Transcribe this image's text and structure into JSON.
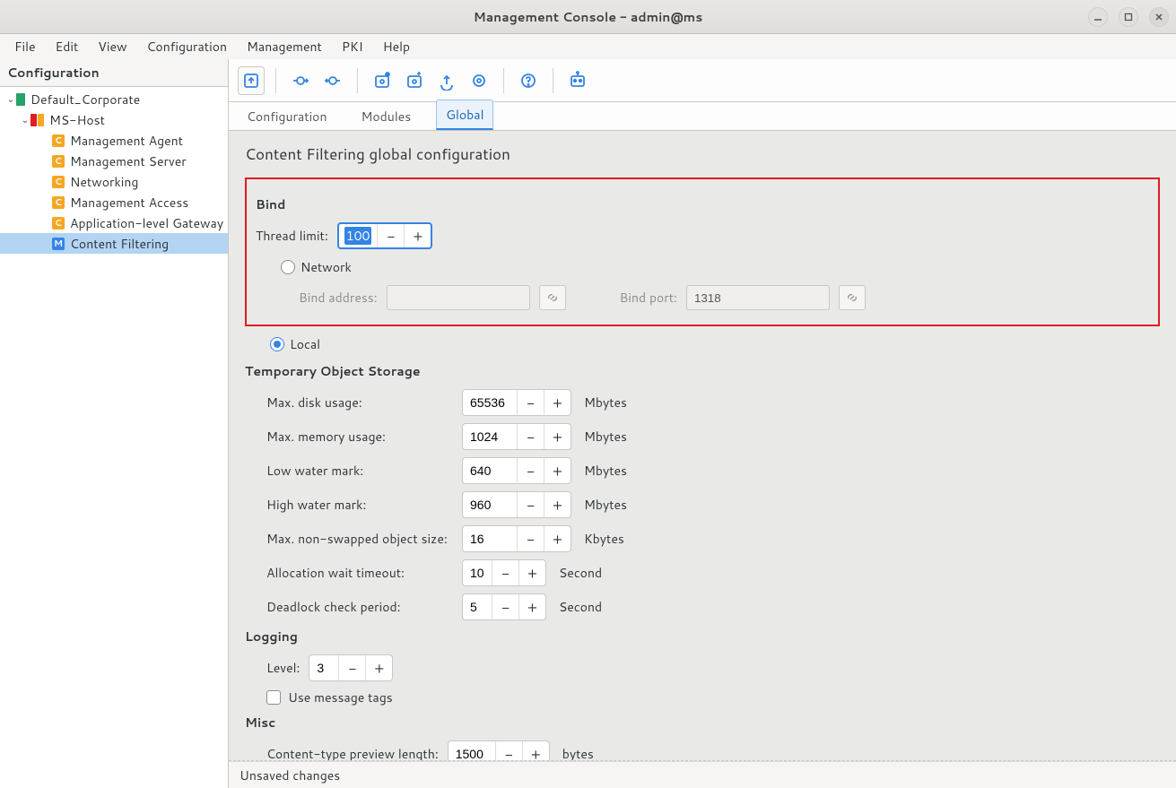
{
  "window": {
    "title": "Management Console - admin@ms"
  },
  "menubar": [
    "File",
    "Edit",
    "View",
    "Configuration",
    "Management",
    "PKI",
    "Help"
  ],
  "sidebar": {
    "header": "Configuration",
    "root": "Default_Corporate",
    "host": "MS-Host",
    "items": [
      {
        "badge": "C",
        "label": "Management Agent"
      },
      {
        "badge": "C",
        "label": "Management Server"
      },
      {
        "badge": "C",
        "label": "Networking"
      },
      {
        "badge": "C",
        "label": "Management Access"
      },
      {
        "badge": "C",
        "label": "Application-level Gateway"
      },
      {
        "badge": "M",
        "label": "Content Filtering",
        "selected": true
      }
    ]
  },
  "tabs": [
    "Configuration",
    "Modules",
    "Global"
  ],
  "active_tab": "Global",
  "page_title": "Content Filtering global configuration",
  "bind": {
    "section": "Bind",
    "thread_label": "Thread limit:",
    "thread_value": "100",
    "radio_network": "Network",
    "radio_local": "Local",
    "bind_address_label": "Bind address:",
    "bind_address_value": "",
    "bind_port_label": "Bind port:",
    "bind_port_value": "1318"
  },
  "storage": {
    "section": "Temporary Object Storage",
    "rows": [
      {
        "label": "Max. disk usage:",
        "value": "65536",
        "unit": "Mbytes"
      },
      {
        "label": "Max. memory usage:",
        "value": "1024",
        "unit": "Mbytes"
      },
      {
        "label": "Low water mark:",
        "value": "640",
        "unit": "Mbytes"
      },
      {
        "label": "High water mark:",
        "value": "960",
        "unit": "Mbytes"
      },
      {
        "label": "Max. non-swapped object size:",
        "value": "16",
        "unit": "Kbytes"
      },
      {
        "label": "Allocation wait timeout:",
        "value": "10",
        "unit": "Second"
      },
      {
        "label": "Deadlock check period:",
        "value": "5",
        "unit": "Second"
      }
    ]
  },
  "logging": {
    "section": "Logging",
    "level_label": "Level:",
    "level_value": "3",
    "use_tags": "Use message tags"
  },
  "misc": {
    "section": "Misc",
    "preview_label": "Content-type preview length:",
    "preview_value": "1500",
    "preview_unit": "bytes"
  },
  "status": "Unsaved changes"
}
